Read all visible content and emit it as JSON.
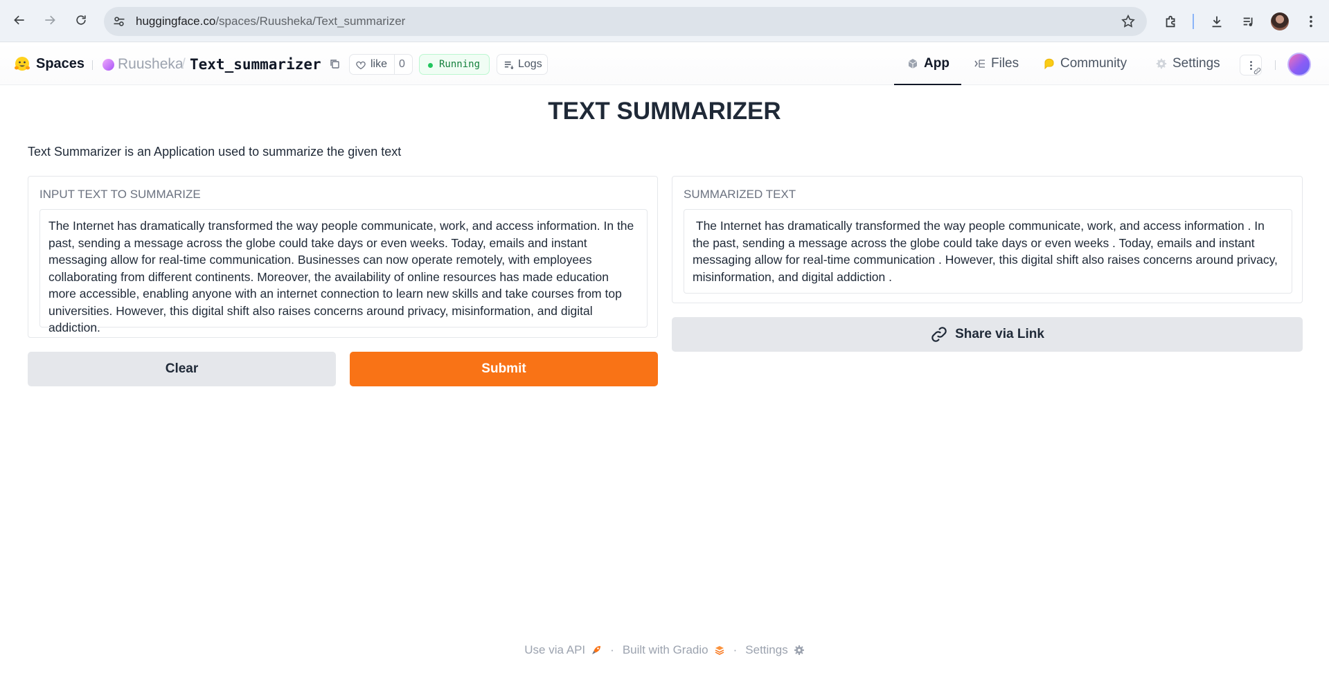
{
  "browser": {
    "url_host": "huggingface.co",
    "url_path": "/spaces/Ruusheka/Text_summarizer"
  },
  "header": {
    "spaces_label": "Spaces",
    "owner": "Ruusheka",
    "separator": "/",
    "space_name": "Text_summarizer",
    "like_label": "like",
    "like_count": "0",
    "status": "Running",
    "logs_label": "Logs",
    "tabs": [
      {
        "label": "App",
        "icon": "cube-icon",
        "active": true
      },
      {
        "label": "Files",
        "icon": "files-icon",
        "active": false
      },
      {
        "label": "Community",
        "icon": "community-icon",
        "active": false
      },
      {
        "label": "Settings",
        "icon": "gear-icon",
        "active": false
      }
    ]
  },
  "app": {
    "title": "TEXT SUMMARIZER",
    "description": "Text Summarizer is an Application used to summarize the given text",
    "input_label": "INPUT TEXT TO SUMMARIZE",
    "input_value": "The Internet has dramatically transformed the way people communicate, work, and access information. In the past, sending a message across the globe could take days or even weeks. Today, emails and instant messaging allow for real-time communication. Businesses can now operate remotely, with employees collaborating from different continents. Moreover, the availability of online resources has made education more accessible, enabling anyone with an internet connection to learn new skills and take courses from top universities. However, this digital shift also raises concerns around privacy, misinformation, and digital addiction.",
    "output_label": "SUMMARIZED TEXT",
    "output_value": " The Internet has dramatically transformed the way people communicate, work, and access information . In the past, sending a message across the globe could take days or even weeks . Today, emails and instant messaging allow for real-time communication . However, this digital shift also raises concerns around privacy, misinformation, and digital addiction .",
    "clear_label": "Clear",
    "submit_label": "Submit",
    "share_label": "Share via Link"
  },
  "footer": {
    "api_label": "Use via API",
    "separator": "·",
    "gradio_label": "Built with Gradio",
    "settings_label": "Settings"
  },
  "colors": {
    "submit": "#f97316",
    "running": "#22c55e",
    "secondary_button": "#e5e7eb"
  }
}
